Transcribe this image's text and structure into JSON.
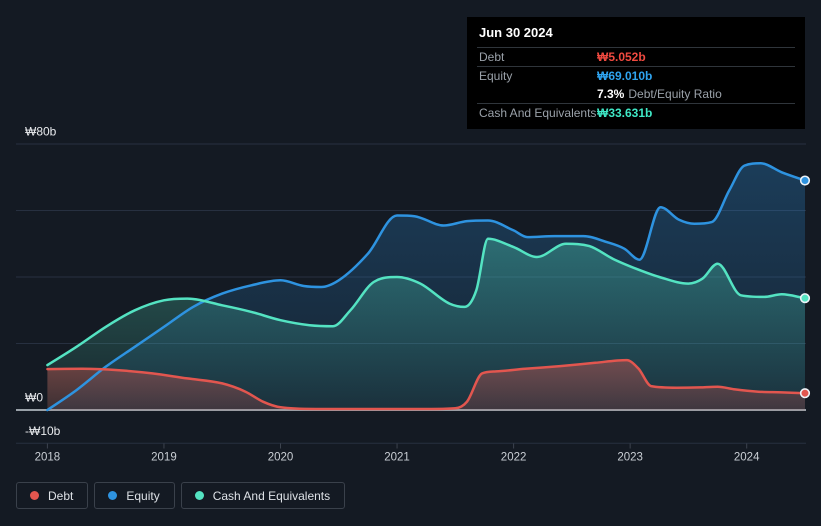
{
  "page": {
    "bg": "#141a23"
  },
  "tooltip": {
    "date": "Jun 30 2024",
    "rows": [
      {
        "label": "Debt",
        "value": "₩5.052b",
        "value_color": "#f04a40"
      },
      {
        "label": "Equity",
        "value": "₩69.010b",
        "value_color": "#2fa4f0"
      },
      {
        "label": "Cash And Equivalents",
        "value": "₩33.631b",
        "value_color": "#3fe8c6"
      }
    ],
    "ratio_pct": "7.3%",
    "ratio_label": "Debt/Equity Ratio",
    "colors": {
      "bg": "#000000",
      "title": "#ffffff",
      "label": "#9aa1a9",
      "divider": "#2f353b"
    }
  },
  "legend": {
    "items": [
      {
        "label": "Debt",
        "color": "#e2564f"
      },
      {
        "label": "Equity",
        "color": "#2e93e0"
      },
      {
        "label": "Cash And Equivalents",
        "color": "#54e3c2"
      }
    ]
  },
  "chart_data": {
    "type": "area",
    "x_range": [
      2018,
      2024.5
    ],
    "x_ticks": [
      2018,
      2019,
      2020,
      2021,
      2022,
      2023,
      2024
    ],
    "y_gridlines": [
      80,
      60,
      40,
      20,
      0,
      -10
    ],
    "y_ticks": [
      {
        "label": "₩80b",
        "value": 80
      },
      {
        "label": "₩0",
        "value": 0
      },
      {
        "label": "-₩10b",
        "value": -10
      }
    ],
    "grid": true,
    "legend_position": "bottom-left",
    "unit_note": "values in ₩ billions",
    "colors": {
      "grid": "#273040",
      "zero_line": "#99a1a8",
      "tick": "#3c434e",
      "x_text": "#c9ced4",
      "y_text": "#e9ebee"
    },
    "series": [
      {
        "name": "Equity",
        "color": "#2e93e0",
        "fill_rgb": "46,147,224",
        "points": [
          [
            2018,
            0
          ],
          [
            2018.25,
            6
          ],
          [
            2018.5,
            13
          ],
          [
            2018.75,
            19
          ],
          [
            2019,
            25
          ],
          [
            2019.25,
            31
          ],
          [
            2019.5,
            35
          ],
          [
            2019.75,
            37.5
          ],
          [
            2020,
            39
          ],
          [
            2020.2,
            37.3
          ],
          [
            2020.35,
            37
          ],
          [
            2020.5,
            39
          ],
          [
            2020.75,
            47
          ],
          [
            2021,
            58.5
          ],
          [
            2021.15,
            58.3
          ],
          [
            2021.4,
            55.5
          ],
          [
            2021.6,
            56.8
          ],
          [
            2021.78,
            57
          ],
          [
            2022,
            54
          ],
          [
            2022.12,
            52
          ],
          [
            2022.35,
            52.3
          ],
          [
            2022.6,
            52.3
          ],
          [
            2022.8,
            50.5
          ],
          [
            2022.95,
            48.5
          ],
          [
            2023.08,
            45.2
          ],
          [
            2023.26,
            61
          ],
          [
            2023.42,
            57.2
          ],
          [
            2023.55,
            56
          ],
          [
            2023.7,
            56.5
          ],
          [
            2023.85,
            66
          ],
          [
            2023.98,
            73.5
          ],
          [
            2024.12,
            74.2
          ],
          [
            2024.3,
            71.5
          ],
          [
            2024.5,
            69.01
          ]
        ]
      },
      {
        "name": "Cash And Equivalents",
        "color": "#54e3c2",
        "fill_rgb": "84,227,194",
        "points": [
          [
            2018,
            13.5
          ],
          [
            2018.25,
            19
          ],
          [
            2018.5,
            25
          ],
          [
            2018.75,
            30
          ],
          [
            2019,
            33
          ],
          [
            2019.2,
            33.5
          ],
          [
            2019.5,
            31.5
          ],
          [
            2019.75,
            29.5
          ],
          [
            2020,
            27
          ],
          [
            2020.25,
            25.5
          ],
          [
            2020.45,
            25.2
          ],
          [
            2020.6,
            30
          ],
          [
            2020.8,
            38.5
          ],
          [
            2021,
            40
          ],
          [
            2021.2,
            38
          ],
          [
            2021.45,
            32
          ],
          [
            2021.58,
            31
          ],
          [
            2021.68,
            36
          ],
          [
            2021.78,
            51.5
          ],
          [
            2022,
            49
          ],
          [
            2022.2,
            46
          ],
          [
            2022.45,
            50
          ],
          [
            2022.65,
            49.3
          ],
          [
            2022.85,
            45.5
          ],
          [
            2023.05,
            42.5
          ],
          [
            2023.25,
            40
          ],
          [
            2023.5,
            38
          ],
          [
            2023.62,
            39.5
          ],
          [
            2023.75,
            44
          ],
          [
            2023.95,
            34.5
          ],
          [
            2024.15,
            34
          ],
          [
            2024.3,
            34.8
          ],
          [
            2024.5,
            33.631
          ]
        ]
      },
      {
        "name": "Debt",
        "color": "#e2564f",
        "fill_rgb": "226,86,79",
        "points": [
          [
            2018,
            12.3
          ],
          [
            2018.3,
            12.4
          ],
          [
            2018.6,
            12
          ],
          [
            2018.9,
            11
          ],
          [
            2019.2,
            9.5
          ],
          [
            2019.5,
            8
          ],
          [
            2019.7,
            5.5
          ],
          [
            2019.85,
            2.5
          ],
          [
            2020,
            0.8
          ],
          [
            2020.3,
            0.3
          ],
          [
            2020.8,
            0.3
          ],
          [
            2021.3,
            0.3
          ],
          [
            2021.5,
            0.5
          ],
          [
            2021.6,
            2.5
          ],
          [
            2021.73,
            11
          ],
          [
            2021.85,
            11.6
          ],
          [
            2022.1,
            12.4
          ],
          [
            2022.4,
            13.2
          ],
          [
            2022.7,
            14.2
          ],
          [
            2022.97,
            15
          ],
          [
            2023.07,
            12.5
          ],
          [
            2023.18,
            7.2
          ],
          [
            2023.4,
            6.7
          ],
          [
            2023.6,
            6.8
          ],
          [
            2023.75,
            7
          ],
          [
            2023.9,
            6.2
          ],
          [
            2024.1,
            5.5
          ],
          [
            2024.3,
            5.3
          ],
          [
            2024.5,
            5.052
          ]
        ]
      }
    ]
  }
}
